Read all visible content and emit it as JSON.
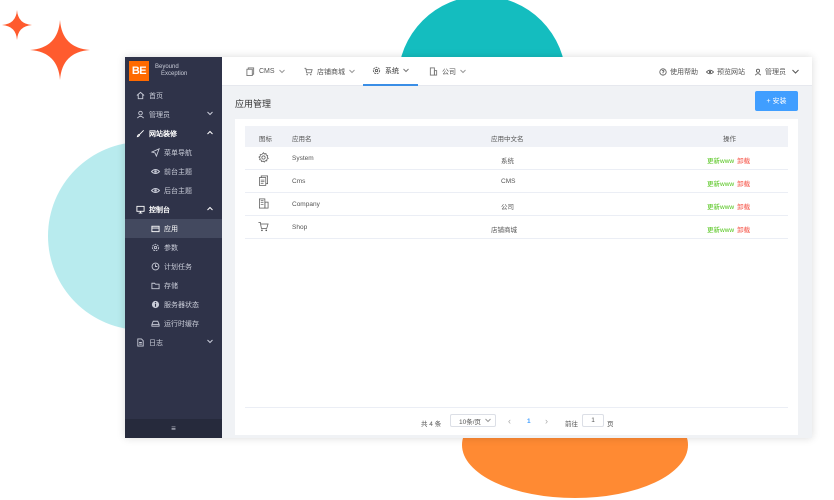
{
  "logo": {
    "mark": "BE",
    "line1": "Beyound",
    "line2": "Exception"
  },
  "sidebar": {
    "items": [
      {
        "label": "首页",
        "icon": "home-icon"
      },
      {
        "label": "管理员",
        "icon": "user-icon"
      },
      {
        "label": "网站装修",
        "icon": "brush-icon"
      },
      {
        "label": "菜单导航",
        "icon": "send-icon"
      },
      {
        "label": "前台主题",
        "icon": "eye-icon"
      },
      {
        "label": "后台主题",
        "icon": "eye-icon"
      },
      {
        "label": "控制台",
        "icon": "monitor-icon"
      },
      {
        "label": "应用",
        "icon": "box-icon"
      },
      {
        "label": "参数",
        "icon": "gear-icon"
      },
      {
        "label": "计划任务",
        "icon": "clock-icon"
      },
      {
        "label": "存储",
        "icon": "folder-icon"
      },
      {
        "label": "服务器状态",
        "icon": "info-icon"
      },
      {
        "label": "运行时缓存",
        "icon": "drive-icon"
      },
      {
        "label": "日志",
        "icon": "document-icon"
      }
    ],
    "footer": "≡"
  },
  "topbar": {
    "tabs": [
      {
        "label": "CMS"
      },
      {
        "label": "店铺商城"
      },
      {
        "label": "系统"
      },
      {
        "label": "公司"
      }
    ],
    "help": "使用帮助",
    "preview": "预览网站",
    "admin": "管理员"
  },
  "page": {
    "title": "应用管理",
    "install_label": "+ 安装"
  },
  "table": {
    "columns": [
      "图标",
      "应用名",
      "应用中文名",
      "操作"
    ],
    "rows": [
      {
        "name": "System",
        "cn": "系统",
        "icon": "gear-icon"
      },
      {
        "name": "Cms",
        "cn": "CMS",
        "icon": "documents-icon"
      },
      {
        "name": "Company",
        "cn": "公司",
        "icon": "building-icon"
      },
      {
        "name": "Shop",
        "cn": "店铺商城",
        "icon": "cart-icon"
      }
    ],
    "action_update": "更新www",
    "action_uninstall": "卸载"
  },
  "pagination": {
    "total": "共 4 条",
    "page_size": "10条/页",
    "prev": "‹",
    "current": "1",
    "next": "›",
    "goto_label": "前往",
    "goto_value": "1",
    "page_suffix": "页"
  },
  "colors": {
    "sidebar_bg": "#2f3349",
    "primary": "#409eff",
    "logo": "#ff6a00",
    "update": "#52c41a",
    "uninstall": "#f5483b"
  }
}
